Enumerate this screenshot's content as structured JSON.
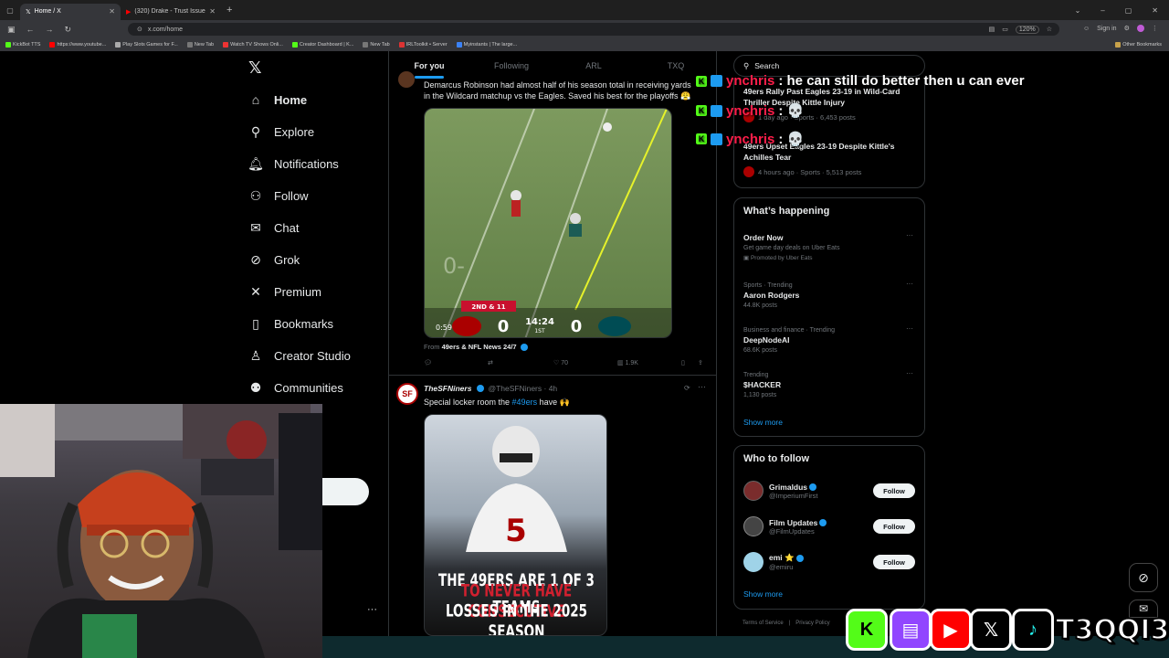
{
  "browser": {
    "tabs": [
      {
        "label": "Home / X",
        "active": true
      },
      {
        "label": "(320) Drake - Trust Issues - You",
        "active": false
      }
    ],
    "url": "x.com/home",
    "zoom": "120%",
    "signin": "Sign in",
    "bookmarks": [
      "KickBot TTS",
      "https://www.youtube...",
      "Play Slots Games for F...",
      "New Tab",
      "Watch TV Shows Onli...",
      "Creator Dashboard | K...",
      "New Tab",
      "IRLToolkit • Server",
      "Myinstants | The large..."
    ],
    "other_bookmarks": "Other Bookmarks"
  },
  "nav": [
    {
      "label": "Home",
      "icon": "home-icon",
      "glyph": "⌂"
    },
    {
      "label": "Explore",
      "icon": "search-icon",
      "glyph": "⚲"
    },
    {
      "label": "Notifications",
      "icon": "bell-icon",
      "glyph": "♫"
    },
    {
      "label": "Follow",
      "icon": "add-person-icon",
      "glyph": "⚇"
    },
    {
      "label": "Chat",
      "icon": "mail-icon",
      "glyph": "✉"
    },
    {
      "label": "Grok",
      "icon": "grok-icon",
      "glyph": "⊘"
    },
    {
      "label": "Premium",
      "icon": "x-logo-icon",
      "glyph": "✕"
    },
    {
      "label": "Bookmarks",
      "icon": "bookmark-icon",
      "glyph": "▯"
    },
    {
      "label": "Creator Studio",
      "icon": "creator-icon",
      "glyph": "♙"
    },
    {
      "label": "Communities",
      "icon": "communities-icon",
      "glyph": "⚉"
    }
  ],
  "feed_tabs": [
    "For you",
    "Following",
    "ARL",
    "TXQ"
  ],
  "tweet1": {
    "text": "Demarcus Robinson had almost half of his season total in receiving yards in the Wildcard matchup vs the Eagles. Saved his best for the playoffs 😤",
    "video_time": "0:59",
    "score_down": "2ND & 11",
    "score_left": "0",
    "score_clock": "14:24",
    "score_qtr": "1ST",
    "score_right": "0",
    "from_label": "From",
    "from_source": "49ers & NFL News 24/7",
    "likes": "70",
    "views": "1.9K"
  },
  "tweet2": {
    "name": "TheSFNiners",
    "handle": "@TheSFNiners · 4h",
    "text_pre": "Special locker room the ",
    "hashtag": "#49ers",
    "text_post": " have 🙌",
    "image_line1": "THE 49ERS ARE 1 OF 3 TEAMS",
    "image_line2": "TO NEVER HAVE CONSECUTIVE",
    "image_line3": "LOSSES IN THE 2025 SEASON"
  },
  "search": {
    "placeholder": "Search"
  },
  "news": [
    {
      "title": "49ers Rally Past Eagles 23-19 in Wild-Card Thriller Despite Kittle Injury",
      "meta": "1 day ago · Sports · 6,453 posts"
    },
    {
      "title": "49ers Upset Eagles 23-19 Despite Kittle's Achilles Tear",
      "meta": "4 hours ago · Sports · 5,513 posts"
    }
  ],
  "happening": {
    "title": "What’s happening",
    "items": [
      {
        "context": "",
        "name": "Order Now",
        "sub": "Get game day deals on Uber Eats",
        "extra": "Promoted by Uber Eats"
      },
      {
        "context": "Sports · Trending",
        "name": "Aaron Rodgers",
        "sub": "44.8K posts",
        "extra": ""
      },
      {
        "context": "Business and finance · Trending",
        "name": "DeepNodeAI",
        "sub": "68.6K posts",
        "extra": ""
      },
      {
        "context": "Trending",
        "name": "$HACKER",
        "sub": "1,130 posts",
        "extra": ""
      }
    ],
    "show_more": "Show more"
  },
  "who_to_follow": {
    "title": "Who to follow",
    "accounts": [
      {
        "name": "Grimaldus",
        "handle": "@ImperiumFirst",
        "color": "#7a2c2c"
      },
      {
        "name": "Film Updates",
        "handle": "@FilmUpdates",
        "color": "#444444"
      },
      {
        "name": "emi ⭐",
        "handle": "@emiru",
        "color": "#9fd3e8"
      }
    ],
    "follow_label": "Follow",
    "show_more": "Show more"
  },
  "footer": {
    "terms": "Terms of Service",
    "privacy": "Privacy Policy"
  },
  "chat_overlay": [
    {
      "user": "ynchris",
      "message": ": he can still do better then u can ever"
    },
    {
      "user": "ynchris",
      "message": ": 💀"
    },
    {
      "user": "ynchris",
      "message": ": 💀"
    }
  ],
  "socials": {
    "handle": "T3QQI3"
  },
  "colors": {
    "accent": "#1d9bf0",
    "kick": "#53fc18",
    "twitch": "#9146ff",
    "youtube": "#ff0000",
    "niners_red": "#aa0000"
  }
}
